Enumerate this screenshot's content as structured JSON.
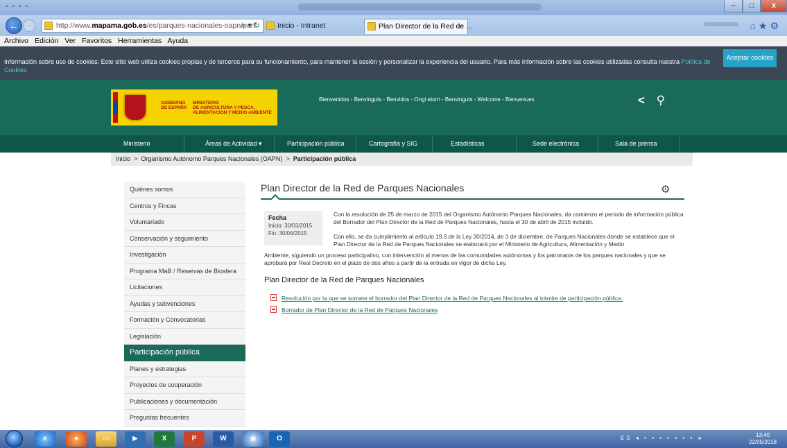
{
  "browser": {
    "url_prefix": "http://www.",
    "url_host": "mapama.gob.es",
    "url_rest": "/es/parques-nacionales-oapn/part",
    "addr_controls": "⌕ ▾ ↻",
    "tab_intranet": "Inicio - Intranet",
    "tab_active": "Plan Director de la Red de ...",
    "tab_close": "×",
    "nav_icons": "⌂★⚙"
  },
  "menu": {
    "items": [
      "Archivo",
      "Edición",
      "Ver",
      "Favoritos",
      "Herramientas",
      "Ayuda"
    ]
  },
  "cookie": {
    "text": "Información sobre uso de cookies: Este sitio web utiliza cookies propias y de terceros para su funcionamiento, para mantener la sesión y personalizar la experiencia del usuario. Para más información sobre las cookies utilizadas consulta nuestra ",
    "link": "Política de Cookies",
    "button": "Aceptar cookies"
  },
  "header": {
    "gov_line1": "GOBIERNO",
    "gov_line2": "DE ESPAÑA",
    "min_line1": "MINISTERIO",
    "min_line2": "DE AGRICULTURA Y PESCA,",
    "min_line3": "ALIMENTACIÓN Y MEDIO AMBIENTE",
    "welcome": "Bienvenidos - Benvinguts - Benvidos - Ongi etorri - Benvinguts - Welcome - Bienvenues",
    "share_icon": "<",
    "search_icon": "⚲"
  },
  "mainnav": {
    "items": [
      "Ministerio",
      "Áreas de Actividad  ▾",
      "Participación pública",
      "Cartografía y SIG",
      "Estadísticas",
      "Sede electrónica",
      "Sala de prensa"
    ]
  },
  "breadcrumb": {
    "home": "Inicio",
    "sep": ">",
    "level1": "Organismo Autónomo Parques Nacionales (OAPN)",
    "current": "Participación pública"
  },
  "sidebar": {
    "items": [
      "Quiénes somos",
      "Centros y Fincas",
      "Voluntariado",
      "Conservación y seguimiento",
      "Investigación",
      "Programa MaB / Reservas de Biosfera",
      "Licitaciones",
      "Ayudas y subvenciones",
      "Formación y Convocatorias",
      "Legislación",
      "Participación pública",
      "Planes y estrategias",
      "Proyectos de cooperación",
      "Publicaciones y documentación",
      "Preguntas frecuentes"
    ],
    "active_index": 10
  },
  "content": {
    "title": "Plan Director de la Red de Parques Nacionales",
    "fecha_label": "Fecha",
    "inicio": "Inicio: 30/03/2015",
    "fin": "Fin: 30/04/2015",
    "para1": "Con la resolución de 25 de marzo de 2015 del Organismo Autónomo Parques Nacionales, da comienzo el periodo de información pública del Borrador del Plan Director de la Red de Parques Nacionales, hasta el 30 de abril de 2015 incluido.",
    "para2a": "Con ello, se da cumplimiento al artículo 19.3 de la Ley 30/2014, de 3 de diciembre, de Parques Nacionales donde se establece que el Plan Director de la Red de Parques Nacionales se elaborará por el Ministerio de Agricultura, Alimentación y Medio",
    "para2b": "Ambiente, siguiendo un proceso participativo, con intervención al menos de las comunidades autónomas y los patronatos de los parques nacionales y que se aprobará por Real Decreto en el plazo de dos años a partir de la entrada en vigor de dicha Ley.",
    "subheading": "Plan Director de la Red de Parques Nacionales",
    "links": [
      "Resolución por la que se somete el borrador del Plan Director de la Red de Parques Nacionales al trámite de participación pública.",
      "Borrador de Plan Director de la Red de Parques Nacionales"
    ],
    "gears_icon": "⚙"
  },
  "taskbar": {
    "lang": "ES",
    "time": "13:40",
    "date": "22/05/2018"
  }
}
